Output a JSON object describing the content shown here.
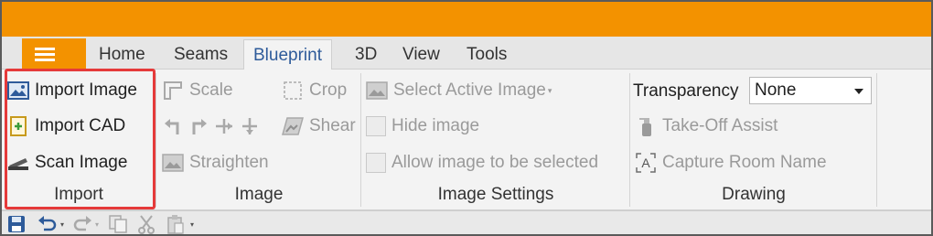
{
  "colors": {
    "accent": "#f39200",
    "active_tab_text": "#2e5b9a",
    "highlight": "#e53a3a"
  },
  "menu": {
    "icon": "hamburger-menu-icon"
  },
  "tabs": [
    {
      "label": "Home"
    },
    {
      "label": "Seams"
    },
    {
      "label": "Blueprint",
      "active": true
    },
    {
      "label": "3D"
    },
    {
      "label": "View"
    },
    {
      "label": "Tools"
    }
  ],
  "groups": {
    "import": {
      "label": "Import",
      "buttons": {
        "import_image": "Import Image",
        "import_cad": "Import CAD",
        "scan_image": "Scan Image"
      }
    },
    "image": {
      "label": "Image",
      "buttons": {
        "scale": "Scale",
        "crop": "Crop",
        "shear": "Shear",
        "straighten": "Straighten"
      }
    },
    "image_settings": {
      "label": "Image Settings",
      "select_active_image": "Select Active Image",
      "hide_image": "Hide image",
      "allow_select": "Allow image to be selected"
    },
    "drawing": {
      "label": "Drawing",
      "transparency_label": "Transparency",
      "transparency_value": "None",
      "take_off_assist": "Take-Off Assist",
      "capture_room_name": "Capture Room Name"
    }
  },
  "quick_access": [
    "save-icon",
    "undo-icon",
    "redo-icon",
    "copy-icon",
    "cut-icon",
    "paste-icon"
  ]
}
